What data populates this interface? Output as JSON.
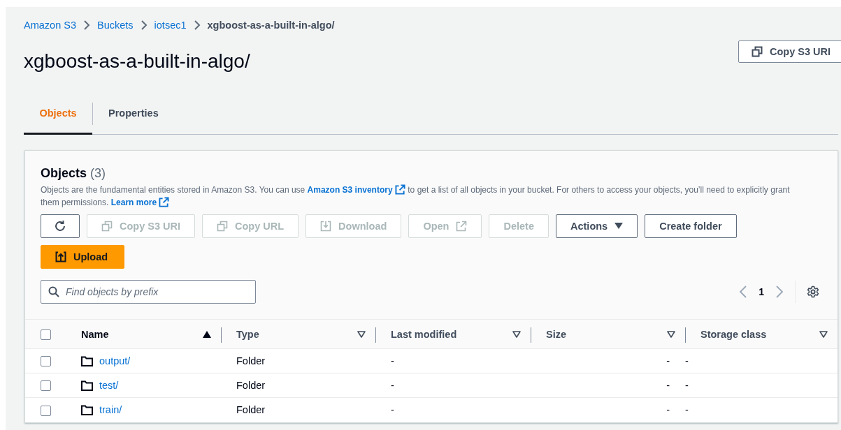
{
  "breadcrumb": [
    {
      "label": "Amazon S3",
      "kind": "link"
    },
    {
      "label": "Buckets",
      "kind": "link"
    },
    {
      "label": "iotsec1",
      "kind": "link"
    },
    {
      "label": "xgboost-as-a-built-in-algo/",
      "kind": "current"
    }
  ],
  "title": "xgboost-as-a-built-in-algo/",
  "header_button": {
    "label": "Copy S3 URI"
  },
  "tabs": [
    {
      "label": "Objects",
      "selected": true
    },
    {
      "label": "Properties",
      "selected": false
    }
  ],
  "panel": {
    "heading": "Objects",
    "count": "(3)",
    "description": [
      {
        "kind": "text",
        "text": "Objects are the fundamental entities stored in Amazon S3. You can use "
      },
      {
        "kind": "link",
        "text": "Amazon S3 inventory"
      },
      {
        "kind": "text",
        "text": " to get a list of all objects in your bucket. For others to access your objects, you’ll need to explicitly grant them permissions. "
      },
      {
        "kind": "link",
        "text": "Learn more"
      }
    ],
    "buttons": [
      {
        "kind": "refresh",
        "disabled": false
      },
      {
        "kind": "copy",
        "label": "Copy S3 URI",
        "disabled": true
      },
      {
        "kind": "copy",
        "label": "Copy URL",
        "disabled": true
      },
      {
        "kind": "download",
        "label": "Download",
        "disabled": true
      },
      {
        "kind": "open",
        "label": "Open",
        "disabled": true
      },
      {
        "kind": "plain",
        "label": "Delete",
        "disabled": true
      },
      {
        "kind": "dropdown",
        "label": "Actions",
        "disabled": false
      },
      {
        "kind": "plain",
        "label": "Create folder",
        "disabled": false
      },
      {
        "kind": "upload",
        "label": "Upload",
        "disabled": false
      }
    ],
    "search": {
      "placeholder": "Find objects by prefix"
    },
    "page": "1"
  },
  "table": {
    "header_checked": false,
    "columns": [
      {
        "label": "Name",
        "sorted": true
      },
      {
        "label": "Type",
        "sorted": false
      },
      {
        "label": "Last modified",
        "sorted": false
      },
      {
        "label": "Size",
        "sorted": false
      },
      {
        "label": "Storage class",
        "sorted": false
      }
    ],
    "rows": [
      {
        "checked": false,
        "name": "output/",
        "type": "Folder",
        "last_modified": "-",
        "size": "-",
        "storage_class": "-"
      },
      {
        "checked": false,
        "name": "test/",
        "type": "Folder",
        "last_modified": "-",
        "size": "-",
        "storage_class": "-"
      },
      {
        "checked": false,
        "name": "train/",
        "type": "Folder",
        "last_modified": "-",
        "size": "-",
        "storage_class": "-"
      }
    ]
  }
}
